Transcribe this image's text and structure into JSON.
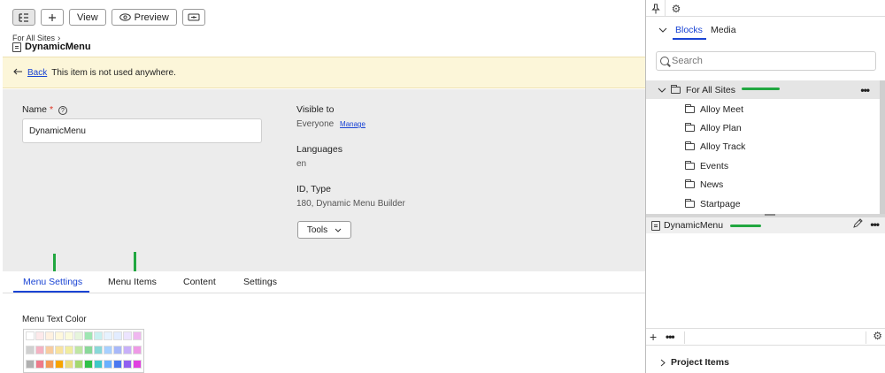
{
  "toolbar": {
    "view_label": "View",
    "preview_label": "Preview"
  },
  "breadcrumb": {
    "text": "For All Sites"
  },
  "page_title": "DynamicMenu",
  "notice": {
    "back_label": "Back",
    "message": "This item is not used anywhere."
  },
  "form": {
    "name_label": "Name",
    "required_mark": "*",
    "name_value": "DynamicMenu",
    "visible_to_label": "Visible to",
    "visible_to_value": "Everyone",
    "manage_link": "Manage",
    "languages_label": "Languages",
    "languages_value": "en",
    "id_type_label": "ID, Type",
    "id_type_value": "180, Dynamic Menu Builder",
    "tools_label": "Tools"
  },
  "tabs": [
    {
      "label": "Menu Settings",
      "active": true
    },
    {
      "label": "Menu Items",
      "active": false
    },
    {
      "label": "Content",
      "active": false
    },
    {
      "label": "Settings",
      "active": false
    }
  ],
  "menu_settings": {
    "text_color_label": "Menu Text Color",
    "palette": [
      "#ffffff",
      "#fde9ea",
      "#fff1e0",
      "#fff8dc",
      "#fbfbdc",
      "#e6f5dc",
      "#9ee6b2",
      "#c8f0f0",
      "#e6f2ff",
      "#e2ecff",
      "#ece4ff",
      "#f0b8f0",
      "#d0d0d0",
      "#f4b2c2",
      "#f7cca0",
      "#f8e2a0",
      "#f0eca0",
      "#bfe6a4",
      "#8ad89a",
      "#8ad8d8",
      "#a8d0ff",
      "#a8b8f8",
      "#c8b0f8",
      "#ee9ae6",
      "#b0b0b0",
      "#ee7a8a",
      "#f39a54",
      "#f7a400",
      "#e8dc80",
      "#a4d870",
      "#30c048",
      "#40c8c8",
      "#6ab0ff",
      "#4a78f0",
      "#9060f0",
      "#e040e0"
    ]
  },
  "right_panel": {
    "tabs": [
      {
        "label": "Blocks",
        "active": true
      },
      {
        "label": "Media",
        "active": false
      }
    ],
    "search_placeholder": "Search",
    "tree": {
      "root": "For All Sites",
      "children": [
        "Alloy Meet",
        "Alloy Plan",
        "Alloy Track",
        "Events",
        "News",
        "Startpage"
      ]
    },
    "selected_item": "DynamicMenu",
    "project_items_label": "Project Items"
  },
  "colors": {
    "accent": "#1a44d4",
    "annotation_green": "#21a740",
    "notice_bg": "#fcf6d9",
    "form_bg": "#ececec"
  }
}
